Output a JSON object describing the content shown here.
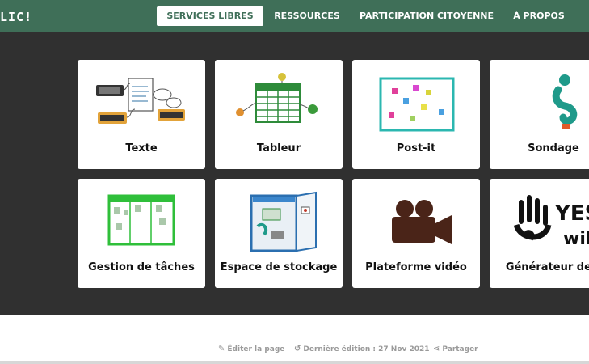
{
  "header": {
    "brand": "CLIC!",
    "nav": [
      {
        "label": "SERVICES LIBRES",
        "active": true
      },
      {
        "label": "RESSOURCES",
        "active": false
      },
      {
        "label": "PARTICIPATION CITOYENNE",
        "active": false
      },
      {
        "label": "À PROPOS",
        "active": false
      }
    ]
  },
  "services": [
    {
      "label": "Texte",
      "icon": "keyboards-chat-icon"
    },
    {
      "label": "Tableur",
      "icon": "spreadsheet-icon"
    },
    {
      "label": "Post-it",
      "icon": "post-it-board-icon"
    },
    {
      "label": "Sondage",
      "icon": "question-person-icon"
    },
    {
      "label": "Gestion de tâches",
      "icon": "kanban-board-icon"
    },
    {
      "label": "Espace de stockage",
      "icon": "storage-cabinet-icon"
    },
    {
      "label": "Plateforme vidéo",
      "icon": "video-camera-icon"
    },
    {
      "label": "Générateur de s",
      "icon": "yeswiki-logo",
      "logo_text": "YES wiki"
    }
  ],
  "footer": {
    "edit": "Éditer la page",
    "last_edit": "Dernière édition : 27 Nov 2021",
    "share": "Partager"
  },
  "colors": {
    "header_bg": "#3f6f58",
    "content_bg": "#303030"
  }
}
